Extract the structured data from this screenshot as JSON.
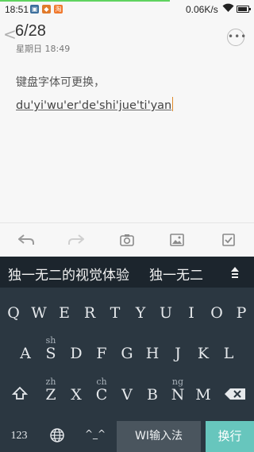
{
  "status_bar": {
    "time": "18:51",
    "net_speed": "0.06K/s",
    "icons": [
      "photo-icon",
      "shop-icon",
      "taobao-icon",
      "wifi-icon",
      "battery-icon"
    ],
    "accent": "#5fd35f"
  },
  "header": {
    "back_glyph": "<",
    "page_indicator": "6/28",
    "date": "星期日 18:49",
    "more_glyph": "•••"
  },
  "note": {
    "line1": "键盘字体可更换，",
    "line2": "du'yi'wu'er'de'shi'jue'ti'yan"
  },
  "toolbar": {
    "items": [
      "undo-icon",
      "redo-icon",
      "camera-icon",
      "image-icon",
      "checkbox-icon"
    ]
  },
  "keyboard": {
    "candidates": [
      "独一无二的视觉体验",
      "独一无二"
    ],
    "row1": [
      "Q",
      "W",
      "E",
      "R",
      "T",
      "Y",
      "U",
      "I",
      "O",
      "P"
    ],
    "row2": [
      "A",
      "S",
      "D",
      "F",
      "G",
      "H",
      "J",
      "K",
      "L"
    ],
    "row2_hints": {
      "S": "sh"
    },
    "row3": [
      "Z",
      "X",
      "C",
      "V",
      "B",
      "N",
      "M"
    ],
    "row3_hints": {
      "Z": "zh",
      "C": "ch",
      "N": "ng"
    },
    "bottom": {
      "numbers": "123",
      "emoticon": "^_^",
      "space": "WI输入法",
      "enter": "换行"
    },
    "colors": {
      "background": "#2b3741",
      "candidate_bar": "#1c252d",
      "enter": "#67c6bd",
      "space": "#4a555e"
    }
  }
}
